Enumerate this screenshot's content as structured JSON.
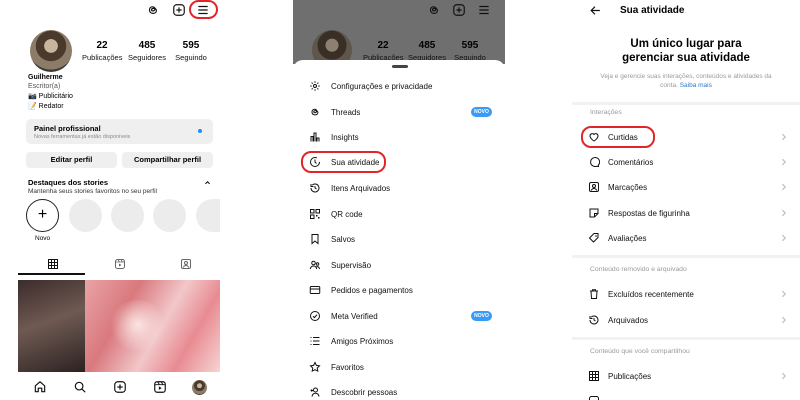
{
  "profile": {
    "username": "Guilherme",
    "bio_lines": [
      "Escritor(a)",
      "📷 Publicitário",
      "📝 Redator"
    ],
    "stats": [
      {
        "value": "22",
        "label": "Publicações"
      },
      {
        "value": "485",
        "label": "Seguidores"
      },
      {
        "value": "595",
        "label": "Seguindo"
      }
    ],
    "pro_panel_title": "Painel profissional",
    "pro_panel_sub": "Novas ferramentas já estão disponíveis",
    "edit_button": "Editar perfil",
    "share_button": "Compartilhar perfil",
    "highlights_title": "Destaques dos stories",
    "highlights_sub": "Mantenha seus stories favoritos no seu perfil",
    "new_story_label": "Novo",
    "new_story_symbol": "+"
  },
  "menu": {
    "stats": [
      {
        "value": "22",
        "label": "Publicações"
      },
      {
        "value": "485",
        "label": "Seguidores"
      },
      {
        "value": "595",
        "label": "Seguindo"
      }
    ],
    "items": [
      {
        "label": "Configurações e privacidade",
        "icon": "gear-icon"
      },
      {
        "label": "Threads",
        "icon": "threads-icon",
        "badge": "NOVO"
      },
      {
        "label": "Insights",
        "icon": "insights-icon"
      },
      {
        "label": "Sua atividade",
        "icon": "activity-icon"
      },
      {
        "label": "Itens Arquivados",
        "icon": "archive-icon"
      },
      {
        "label": "QR code",
        "icon": "qr-code-icon"
      },
      {
        "label": "Salvos",
        "icon": "bookmark-icon"
      },
      {
        "label": "Supervisão",
        "icon": "supervision-icon"
      },
      {
        "label": "Pedidos e pagamentos",
        "icon": "card-icon"
      },
      {
        "label": "Meta Verified",
        "icon": "verified-icon",
        "badge": "NOVO"
      },
      {
        "label": "Amigos Próximos",
        "icon": "close-friends-icon"
      },
      {
        "label": "Favoritos",
        "icon": "star-icon"
      },
      {
        "label": "Descobrir pessoas",
        "icon": "add-person-icon"
      }
    ]
  },
  "activity": {
    "title": "Sua atividade",
    "heading_line1": "Um único lugar para",
    "heading_line2": "gerenciar sua atividade",
    "subtitle": "Veja e gerencie suas interações, conteúdos e atividades da conta.",
    "subtitle_link": "Saiba mais",
    "sections": [
      {
        "label": "Interações",
        "items": [
          "Curtidas",
          "Comentários",
          "Marcações",
          "Respostas de figurinha",
          "Avaliações"
        ]
      },
      {
        "label": "Conteúdo removido e arquivado",
        "items": [
          "Excluídos recentemente",
          "Arquivados"
        ]
      },
      {
        "label": "Conteúdo que você compartilhou",
        "items": [
          "Publicações"
        ]
      }
    ]
  },
  "colors": {
    "highlight_ring": "#e0262b",
    "badge": "#3a9bf5",
    "link": "#2f74c6"
  }
}
